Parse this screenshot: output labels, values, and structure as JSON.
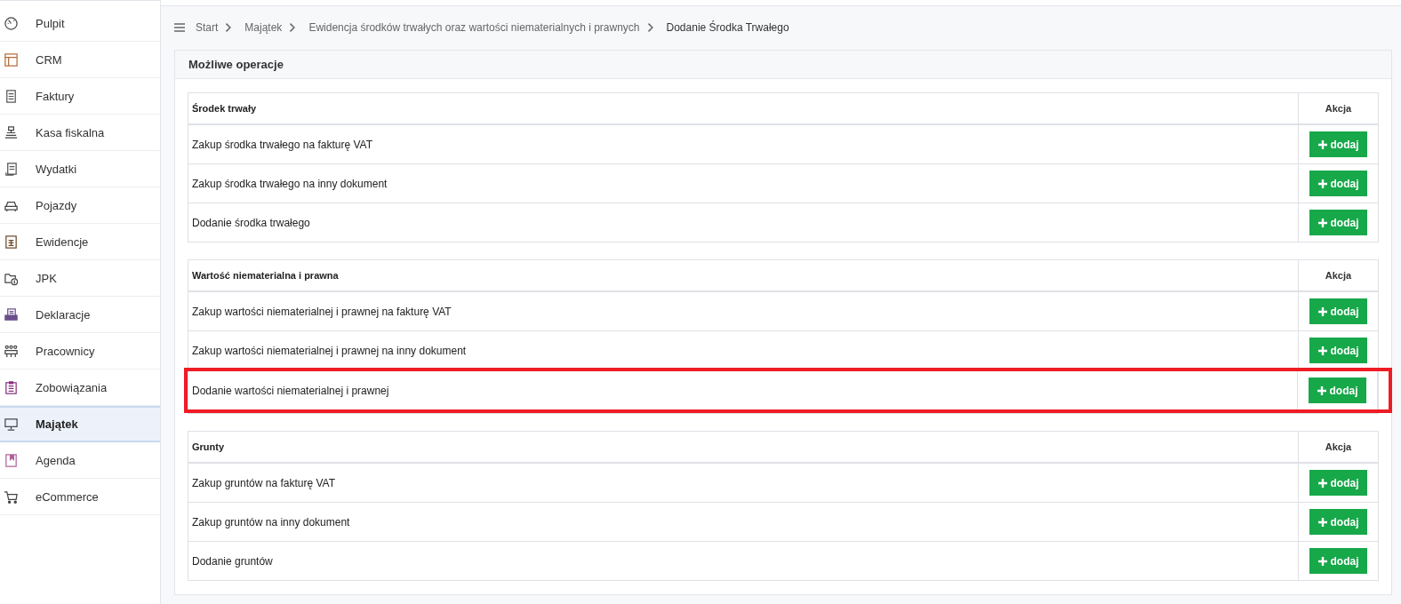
{
  "sidebar": {
    "items": [
      {
        "label": "Pulpit",
        "selected": false
      },
      {
        "label": "CRM",
        "selected": false
      },
      {
        "label": "Faktury",
        "selected": false
      },
      {
        "label": "Kasa fiskalna",
        "selected": false
      },
      {
        "label": "Wydatki",
        "selected": false
      },
      {
        "label": "Pojazdy",
        "selected": false
      },
      {
        "label": "Ewidencje",
        "selected": false
      },
      {
        "label": "JPK",
        "selected": false
      },
      {
        "label": "Deklaracje",
        "selected": false
      },
      {
        "label": "Pracownicy",
        "selected": false
      },
      {
        "label": "Zobowiązania",
        "selected": false
      },
      {
        "label": "Majątek",
        "selected": true
      },
      {
        "label": "Agenda",
        "selected": false
      },
      {
        "label": "eCommerce",
        "selected": false
      }
    ]
  },
  "breadcrumb": [
    "Start",
    "Majątek",
    "Ewidencja środków trwałych oraz wartości niematerialnych i prawnych",
    "Dodanie Środka Trwałego"
  ],
  "card": {
    "title": "Możliwe operacje",
    "sections": [
      {
        "heading": "Środek trwały",
        "action_heading": "Akcja",
        "rows": [
          {
            "label": "Zakup środka trwałego na fakturę VAT",
            "button": "dodaj",
            "highlighted": false
          },
          {
            "label": "Zakup środka trwałego na inny dokument",
            "button": "dodaj",
            "highlighted": false
          },
          {
            "label": "Dodanie środka trwałego",
            "button": "dodaj",
            "highlighted": false
          }
        ]
      },
      {
        "heading": "Wartość niematerialna i prawna",
        "action_heading": "Akcja",
        "rows": [
          {
            "label": "Zakup wartości niematerialnej i prawnej na fakturę VAT",
            "button": "dodaj",
            "highlighted": false
          },
          {
            "label": "Zakup wartości niematerialnej i prawnej na inny dokument",
            "button": "dodaj",
            "highlighted": false
          },
          {
            "label": "Dodanie wartości niematerialnej i prawnej",
            "button": "dodaj",
            "highlighted": true
          }
        ]
      },
      {
        "heading": "Grunty",
        "action_heading": "Akcja",
        "rows": [
          {
            "label": "Zakup gruntów na fakturę VAT",
            "button": "dodaj",
            "highlighted": false
          },
          {
            "label": "Zakup gruntów na inny dokument",
            "button": "dodaj",
            "highlighted": false
          },
          {
            "label": "Dodanie gruntów",
            "button": "dodaj",
            "highlighted": false
          }
        ]
      }
    ]
  }
}
